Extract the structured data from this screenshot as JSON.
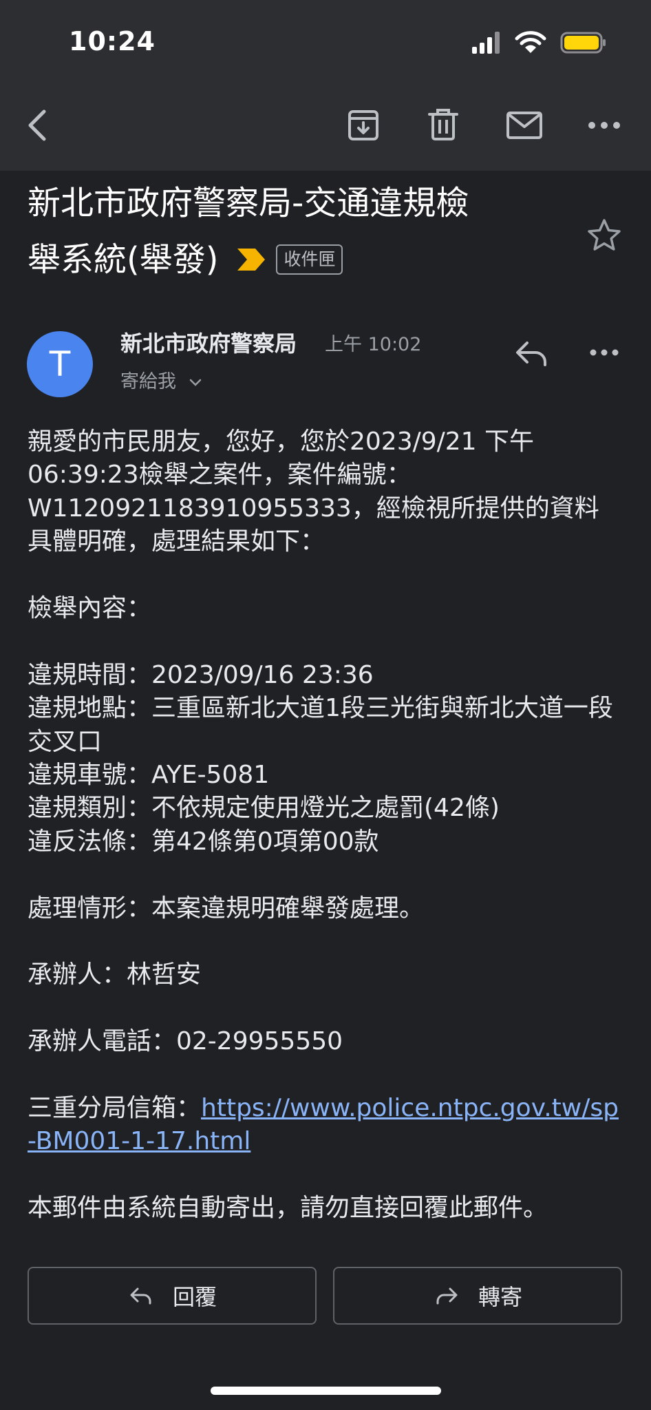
{
  "status_bar": {
    "time": "10:24",
    "icons": [
      "signal-icon",
      "wifi-icon",
      "battery-icon"
    ],
    "battery_color": "#ffd60a"
  },
  "toolbar": {
    "icons": [
      "back-arrow-icon",
      "archive-icon",
      "trash-icon",
      "mail-icon",
      "more-horizontal-icon"
    ]
  },
  "email": {
    "subject_line1": "新北市政府警察局-交通違規檢",
    "subject_line2": "舉系統(舉發)",
    "label_color": "#f6b400",
    "folder_chip": "收件匣",
    "sender": {
      "avatar_letter": "T",
      "avatar_color": "#4a84ee",
      "name": "新北市政府警察局",
      "time": "上午 10:02",
      "recipient": "寄給我"
    },
    "body": {
      "greeting": "親愛的市民朋友，您好，您於2023/9/21 下午06:39:23檢舉之案件，案件編號：W1120921183910955333，經檢視所提供的資料具體明確，處理結果如下：",
      "section_title": "檢舉內容：",
      "violation_time": "違規時間：2023/09/16 23:36",
      "violation_place": "違規地點：三重區新北大道1段三光街與新北大道一段交叉口",
      "plate": "違規車號：AYE-5081",
      "category": "違規類別：不依規定使用燈光之處罰(42條)",
      "law": "違反法條：第42條第0項第00款",
      "result": "處理情形：本案違規明確舉發處理。",
      "officer": "承辦人：林哲安",
      "phone": "承辦人電話：02-29955550",
      "mailbox_label": "三重分局信箱：",
      "mailbox_link": "https://www.police.ntpc.gov.tw/sp-BM001-1-17.html",
      "footer": "本郵件由系統自動寄出，請勿直接回覆此郵件。"
    }
  },
  "actions": {
    "reply": "回覆",
    "forward": "轉寄"
  }
}
